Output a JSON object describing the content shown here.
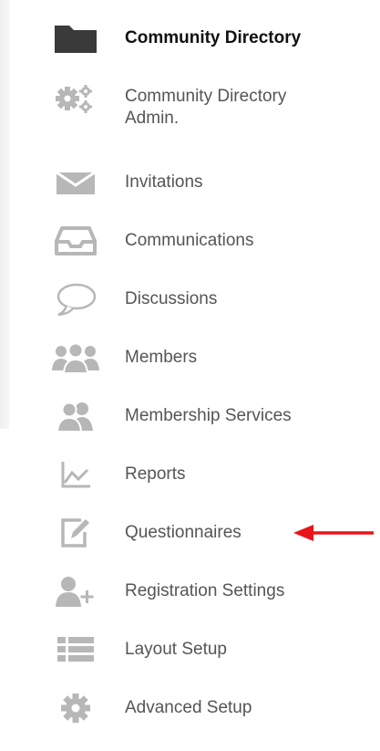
{
  "menu": {
    "items": [
      {
        "label": "Community Directory",
        "icon": "folder-icon"
      },
      {
        "label": "Community Directory\nAdmin.",
        "icon": "gears-icon"
      },
      {
        "label": "Invitations",
        "icon": "envelope-icon"
      },
      {
        "label": "Communications",
        "icon": "inbox-tray-icon"
      },
      {
        "label": "Discussions",
        "icon": "speech-bubble-icon"
      },
      {
        "label": "Members",
        "icon": "group-icon"
      },
      {
        "label": "Membership Services",
        "icon": "users-icon"
      },
      {
        "label": "Reports",
        "icon": "line-chart-icon"
      },
      {
        "label": "Questionnaires",
        "icon": "edit-square-icon"
      },
      {
        "label": "Registration Settings",
        "icon": "user-add-icon"
      },
      {
        "label": "Layout Setup",
        "icon": "list-layout-icon"
      },
      {
        "label": "Advanced Setup",
        "icon": "gear-icon"
      }
    ]
  },
  "colors": {
    "icon": "#b7b7b7",
    "active_icon": "#3a3a3a",
    "text": "#555555",
    "active_text": "#111111",
    "annotation_arrow": "#e8141a"
  }
}
